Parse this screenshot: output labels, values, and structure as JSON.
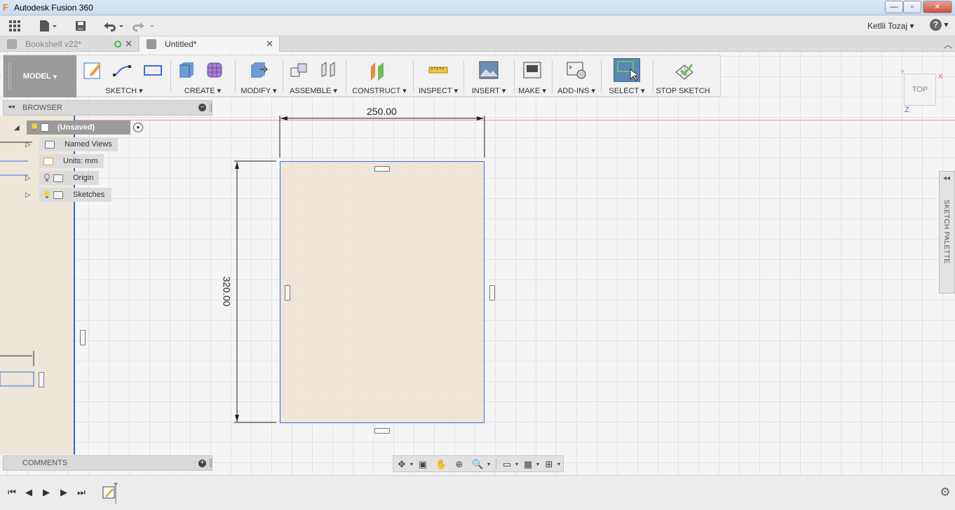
{
  "window": {
    "title": "Autodesk Fusion 360"
  },
  "appbar": {
    "user_name": "Ketlli Tozaj"
  },
  "tabs": [
    {
      "label": "Bookshelf v22*",
      "active": false
    },
    {
      "label": "Untitled*",
      "active": true
    }
  ],
  "toolbar": {
    "workspace": "MODEL",
    "groups": [
      {
        "label": "SKETCH"
      },
      {
        "label": "CREATE"
      },
      {
        "label": "MODIFY"
      },
      {
        "label": "ASSEMBLE"
      },
      {
        "label": "CONSTRUCT"
      },
      {
        "label": "INSPECT"
      },
      {
        "label": "INSERT"
      },
      {
        "label": "MAKE"
      },
      {
        "label": "ADD-INS"
      },
      {
        "label": "SELECT"
      },
      {
        "label": "STOP SKETCH"
      }
    ]
  },
  "browser": {
    "title": "BROWSER",
    "nodes": [
      {
        "label": "(Unsaved)"
      },
      {
        "label": "Named Views"
      },
      {
        "label": "Units: mm"
      },
      {
        "label": "Origin"
      },
      {
        "label": "Sketches"
      }
    ]
  },
  "sketch": {
    "width_dim": "250.00",
    "height_dim": "320.00"
  },
  "viewcube": {
    "face": "TOP",
    "axes": {
      "x": "X",
      "y": "Y",
      "z": "Z"
    }
  },
  "sketch_palette": {
    "label": "SKETCH PALETTE"
  },
  "comments": {
    "title": "COMMENTS"
  },
  "colors": {
    "sketch_fill": "#eee2d2",
    "sketch_line": "#3a6fdc",
    "x_axis": "#e05555",
    "model_bg": "#9a9a9a",
    "select_active": "#5b86b5"
  }
}
